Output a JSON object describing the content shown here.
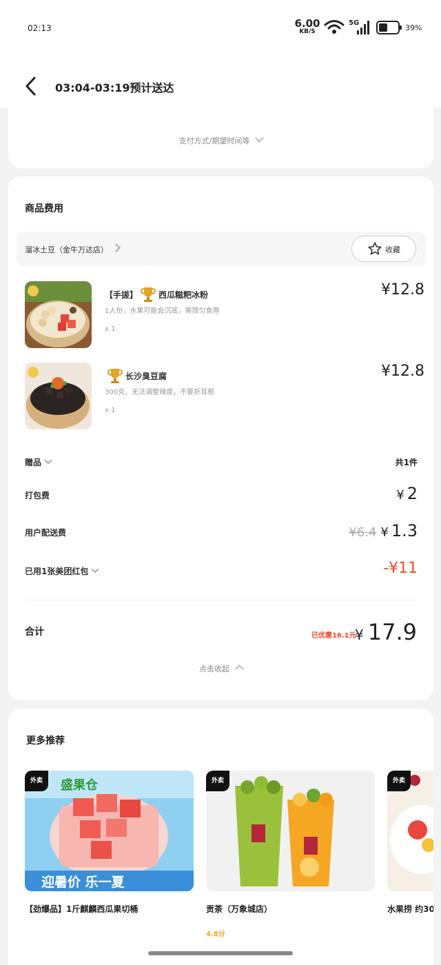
{
  "status_bar": {
    "time": "02:13",
    "net_speed": "6.00",
    "net_unit": "KB/S",
    "network": "5G",
    "battery": "39%"
  },
  "header": {
    "title": "03:04-03:19预计送达"
  },
  "payment": {
    "toggle_label": "支付方式/期望时间等"
  },
  "order": {
    "section_title": "商品费用",
    "store_name": "溜冰土豆（金牛万达店）",
    "favorite_label": "收藏",
    "items": [
      {
        "name_prefix": "【手搓】",
        "name": "西瓜糍粑冰粉",
        "desc": "1人份，水果可能会沉底，需搅匀食用",
        "qty": "x 1",
        "price": "¥12.8"
      },
      {
        "name_prefix": "",
        "name": "长沙臭豆腐",
        "desc": "300克，无法调整辣度，不要折耳根",
        "qty": "x 1",
        "price": "¥12.8"
      }
    ],
    "gift_label": "赠品",
    "gift_count": "共1件",
    "packing_label": "打包费",
    "packing_symbol": "¥",
    "packing_value": "2",
    "delivery_label": "用户配送费",
    "delivery_original": "¥6.4",
    "delivery_symbol": "¥",
    "delivery_value": "1.3",
    "coupon_label": "已用1张美团红包",
    "coupon_value": "-¥11",
    "total_label": "合计",
    "saved_text": "已优惠16.1元",
    "total_symbol": "¥",
    "total_value": "17.9",
    "collapse_label": "点击收起"
  },
  "recommendations": {
    "title": "更多推荐",
    "items": [
      {
        "badge": "外卖",
        "name": "【劲爆品】1斤麒麟西瓜果切桶",
        "rating": "",
        "brand_text": "盛果仓",
        "banner_text": "迎暑价 乐一夏"
      },
      {
        "badge": "外卖",
        "name": "贡茶（万象城店）",
        "rating": "4.8分",
        "brand_text": ""
      },
      {
        "badge": "外卖",
        "name": "水果捞 约30",
        "rating": ""
      }
    ]
  },
  "colors": {
    "accent_red": "#f04a27",
    "rating_orange": "#f5a623"
  }
}
